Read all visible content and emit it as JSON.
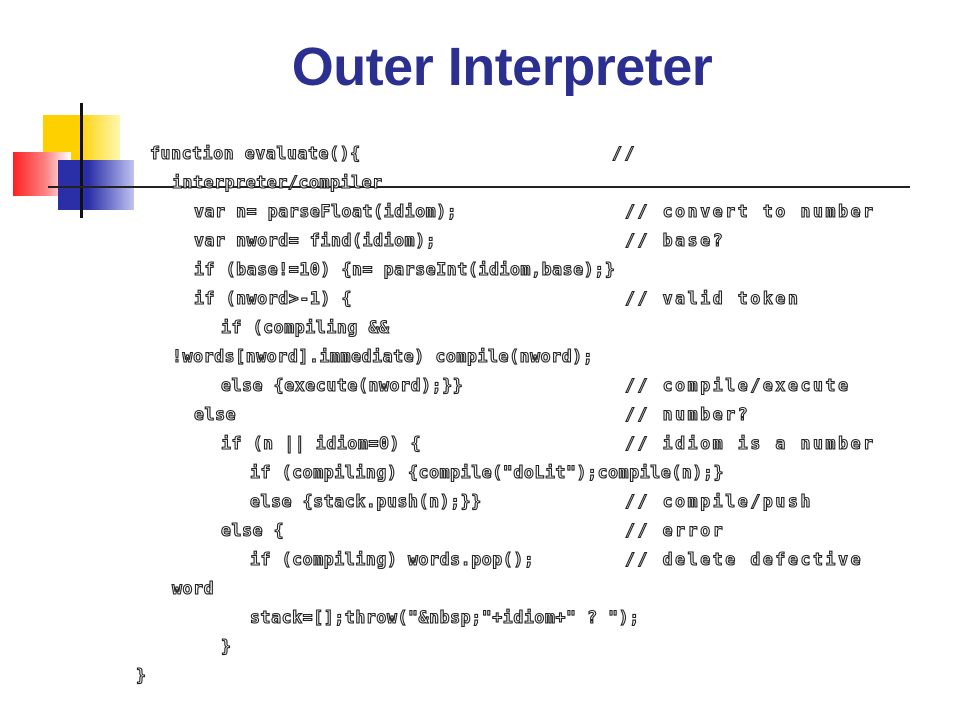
{
  "slide": {
    "title": "Outer Interpreter",
    "lines": [
      "function evaluate(){",
      "interpreter/compiler",
      "var n= parseFloat(idiom);",
      "var nword= find(idiom);",
      "if (base!=10) {n= parseInt(idiom,base);}",
      "if (nword>-1) {",
      "if (compiling &&",
      "!words[nword].immediate) compile(nword);",
      "else {execute(nword);}}",
      "else",
      "if (n || idiom=0) {",
      "if (compiling) {compile(\"doLit\");compile(n);}",
      "else {stack.push(n);}}",
      "else {",
      "if (compiling) words.pop();",
      "word",
      "stack=[];throw(\"&nbsp;\"+idiom+\" ? \");",
      "}",
      "}"
    ],
    "comments": [
      "//",
      "// convert to number",
      "// base?",
      "// valid token",
      "// compile/execute",
      "// number?",
      "// idiom is a number",
      "// compile/push",
      "// error",
      "// delete defective"
    ],
    "colors": {
      "title": "#2b2f8f",
      "yellow": "#ffd000",
      "red": "#ff2020",
      "blue": "#2a2fa8"
    }
  }
}
